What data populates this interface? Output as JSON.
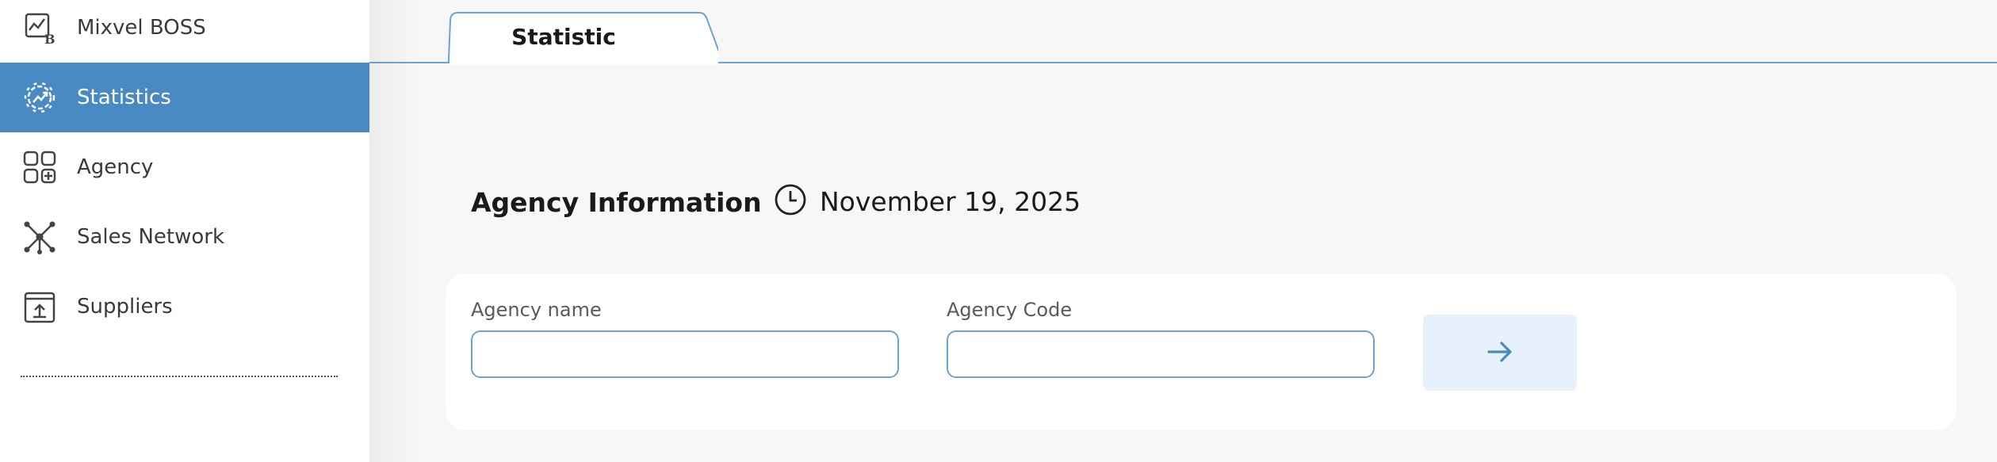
{
  "sidebar": {
    "items": [
      {
        "label": "Mixvel BOSS",
        "icon": "chart-b-icon",
        "active": false
      },
      {
        "label": "Statistics",
        "icon": "gear-chart-icon",
        "active": true
      },
      {
        "label": "Agency",
        "icon": "grid-add-icon",
        "active": false
      },
      {
        "label": "Sales Network",
        "icon": "network-icon",
        "active": false
      },
      {
        "label": "Suppliers",
        "icon": "upload-box-icon",
        "active": false
      }
    ]
  },
  "tabs": [
    {
      "label": "Statistic",
      "active": true
    }
  ],
  "main": {
    "section_title": "Agency Information",
    "date": "November 19, 2025",
    "form": {
      "agency_name_label": "Agency name",
      "agency_name_value": "",
      "agency_code_label": "Agency Code",
      "agency_code_value": ""
    },
    "submit_icon": "arrow-right-icon"
  },
  "colors": {
    "accent": "#4a8ac4",
    "border": "#6aa4d6",
    "button_bg": "#e6f1fb"
  }
}
